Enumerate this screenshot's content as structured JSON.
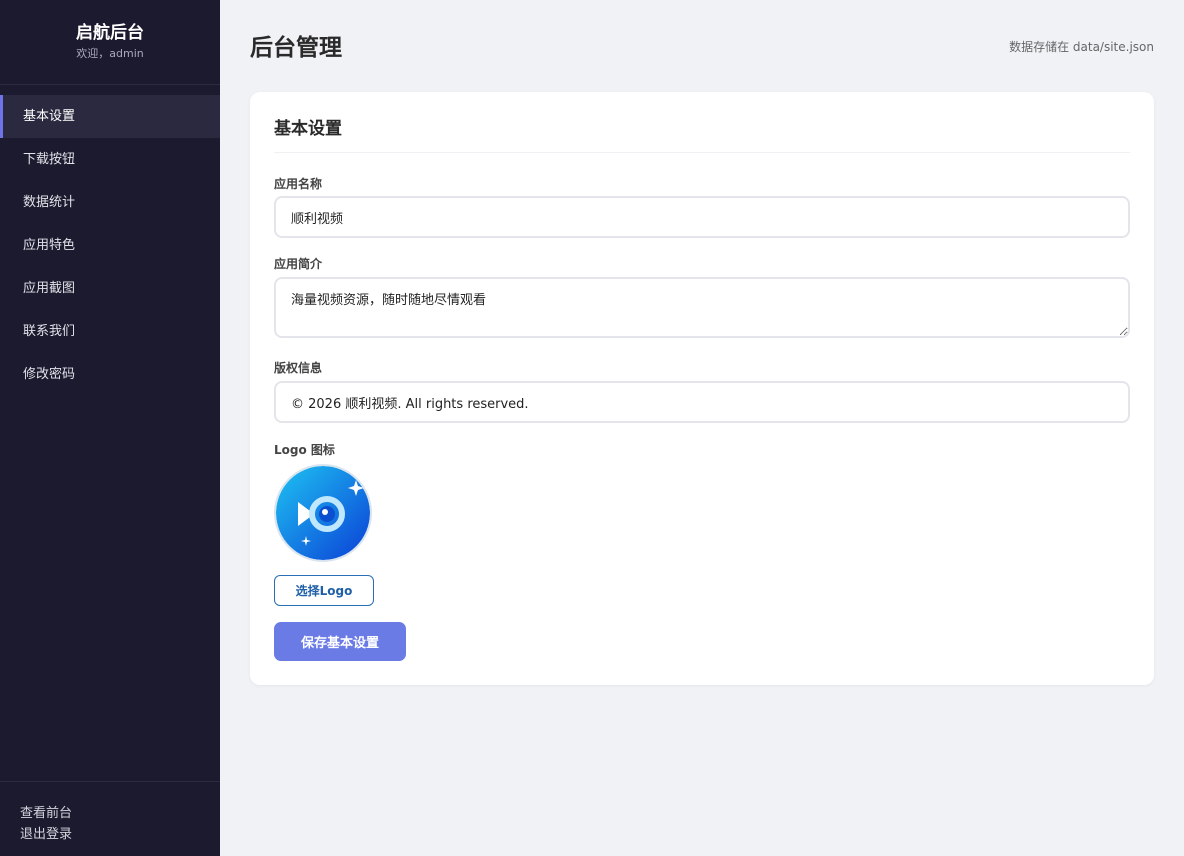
{
  "sidebar": {
    "brand_title": "启航后台",
    "welcome": "欢迎，admin",
    "items": [
      {
        "label": "基本设置"
      },
      {
        "label": "下载按钮"
      },
      {
        "label": "数据统计"
      },
      {
        "label": "应用特色"
      },
      {
        "label": "应用截图"
      },
      {
        "label": "联系我们"
      },
      {
        "label": "修改密码"
      }
    ],
    "active_item": "基本设置",
    "footer": {
      "view_frontend": "查看前台",
      "logout": "退出登录"
    }
  },
  "header": {
    "title": "后台管理",
    "storage_note": "数据存储在 data/site.json"
  },
  "form": {
    "title": "基本设置",
    "app_name": {
      "label": "应用名称",
      "value": "顺利视频"
    },
    "app_intro": {
      "label": "应用简介",
      "value": "海量视频资源，随时随地尽情观看"
    },
    "copyright": {
      "label": "版权信息",
      "value": "© 2026 顺利视频. All rights reserved."
    },
    "logo": {
      "label": "Logo 图标",
      "choose_label": "选择Logo"
    },
    "save_label": "保存基本设置"
  },
  "colors": {
    "sidebar_bg": "#1b1a2e",
    "active_indicator": "#6e74e8",
    "primary_button": "#6b7be6",
    "outline_button": "#2a6fb5",
    "page_bg": "#f0f2f6"
  }
}
